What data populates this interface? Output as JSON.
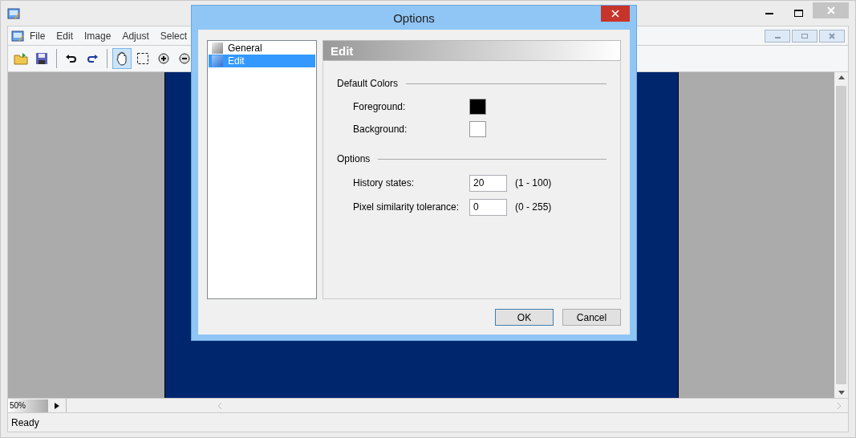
{
  "app": {
    "menu": [
      "File",
      "Edit",
      "Image",
      "Adjust",
      "Select"
    ],
    "toolbar": [
      {
        "kind": "open",
        "selected": false
      },
      {
        "kind": "save",
        "selected": false
      },
      {
        "kind": "sep"
      },
      {
        "kind": "undo",
        "selected": false
      },
      {
        "kind": "redo",
        "selected": false
      },
      {
        "kind": "sep"
      },
      {
        "kind": "hand",
        "selected": true
      },
      {
        "kind": "select",
        "selected": false
      },
      {
        "kind": "zoomin",
        "selected": false
      },
      {
        "kind": "zoomout",
        "selected": false
      }
    ],
    "zoom": "50%",
    "status": "Ready"
  },
  "dialog": {
    "title": "Options",
    "categories": [
      {
        "label": "General",
        "selected": false
      },
      {
        "label": "Edit",
        "selected": true
      }
    ],
    "header": "Edit",
    "groups": [
      {
        "title": "Default Colors",
        "rows": [
          {
            "kind": "color",
            "label": "Foreground:",
            "color": "#000000"
          },
          {
            "kind": "color",
            "label": "Background:",
            "color": "#ffffff"
          }
        ]
      },
      {
        "title": "Options",
        "rows": [
          {
            "kind": "number",
            "label": "History states:",
            "value": "20",
            "range": "(1 - 100)"
          },
          {
            "kind": "number",
            "label": "Pixel similarity tolerance:",
            "value": "0",
            "range": "(0 - 255)"
          }
        ]
      }
    ],
    "buttons": [
      {
        "label": "OK",
        "selected": true
      },
      {
        "label": "Cancel",
        "selected": false
      }
    ]
  }
}
